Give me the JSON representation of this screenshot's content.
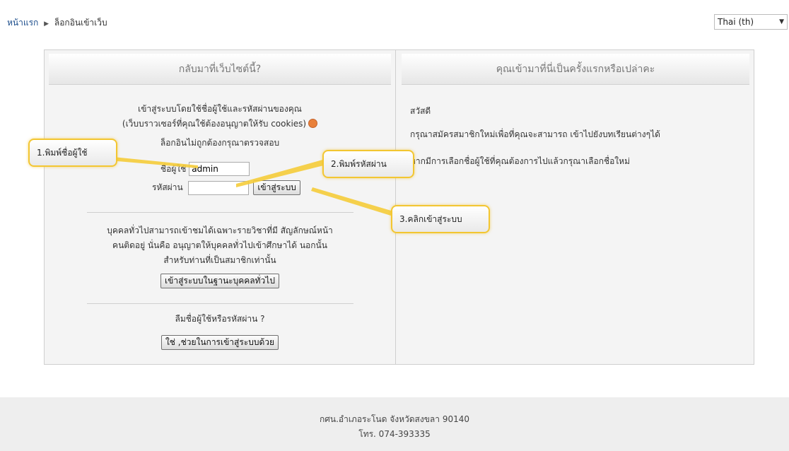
{
  "breadcrumb": {
    "home": "หน้าแรก",
    "separator": "▶",
    "current": "ล็อกอินเข้าเว็บ"
  },
  "language": {
    "selected": "Thai (th)"
  },
  "login_box": {
    "title": "กลับมาที่เว็บไซต์นี้?",
    "intro_line1": "เข้าสู่ระบบโดยใช้ชื่อผู้ใช้และรหัสผ่านของคุณ",
    "intro_line2": "(เว็บบราวเซอร์ที่คุณใช้ต้องอนุญาตให้รับ cookies)",
    "error": "ล็อกอินไม่ถูกต้องกรุณาตรวจสอบ",
    "username_label": "ชื่อผู้ใช้",
    "username_value": "admin",
    "password_label": "รหัสผ่าน",
    "password_value": "",
    "login_button": "เข้าสู่ระบบ",
    "guest_text1": "บุคคลทั่วไปสามารถเข้าชมได้เฉพาะรายวิชาที่มี สัญลักษณ์หน้า",
    "guest_text2": "คนติดอยู่ นั่นคือ อนุญาตให้บุคคลทั่วไปเข้าศึกษาได้ นอกนั้น",
    "guest_text3": "สำหรับท่านที่เป็นสมาชิกเท่านั้น",
    "guest_button": "เข้าสู่ระบบในฐานะบุคคลทั่วไป",
    "forgot_text": "ลืมชื่อผู้ใช้หรือรหัสผ่าน ?",
    "forgot_button": "ใช่ ,ช่วยในการเข้าสู่ระบบด้วย"
  },
  "signup_box": {
    "title": "คุณเข้ามาที่นี่เป็นครั้งแรกหรือเปล่าคะ",
    "greeting": "สวัสดี",
    "line1": "กรุณาสมัครสมาชิกใหม่เพื่อที่คุณจะสามารถ เข้าไปยังบทเรียนต่างๆได้",
    "line2": "หากมีการเลือกชื่อผู้ใช้ที่คุณต้องการไปแล้วกรุณาเลือกชื่อใหม่"
  },
  "callouts": {
    "step1": "1.พิมพ์ชื่อผู้ใช้",
    "step2": "2.พิมพ์รหัสผ่าน",
    "step3": "3.คลิกเข้าสู่ระบบ"
  },
  "footer": {
    "line1": "กศน.อำเภอระโนด จังหวัดสงขลา 90140",
    "line2": "โทร. 074-393335"
  },
  "colors": {
    "link": "#1a4c8b",
    "callout_border": "#f3c631",
    "footer_bg": "#eeeeee"
  }
}
